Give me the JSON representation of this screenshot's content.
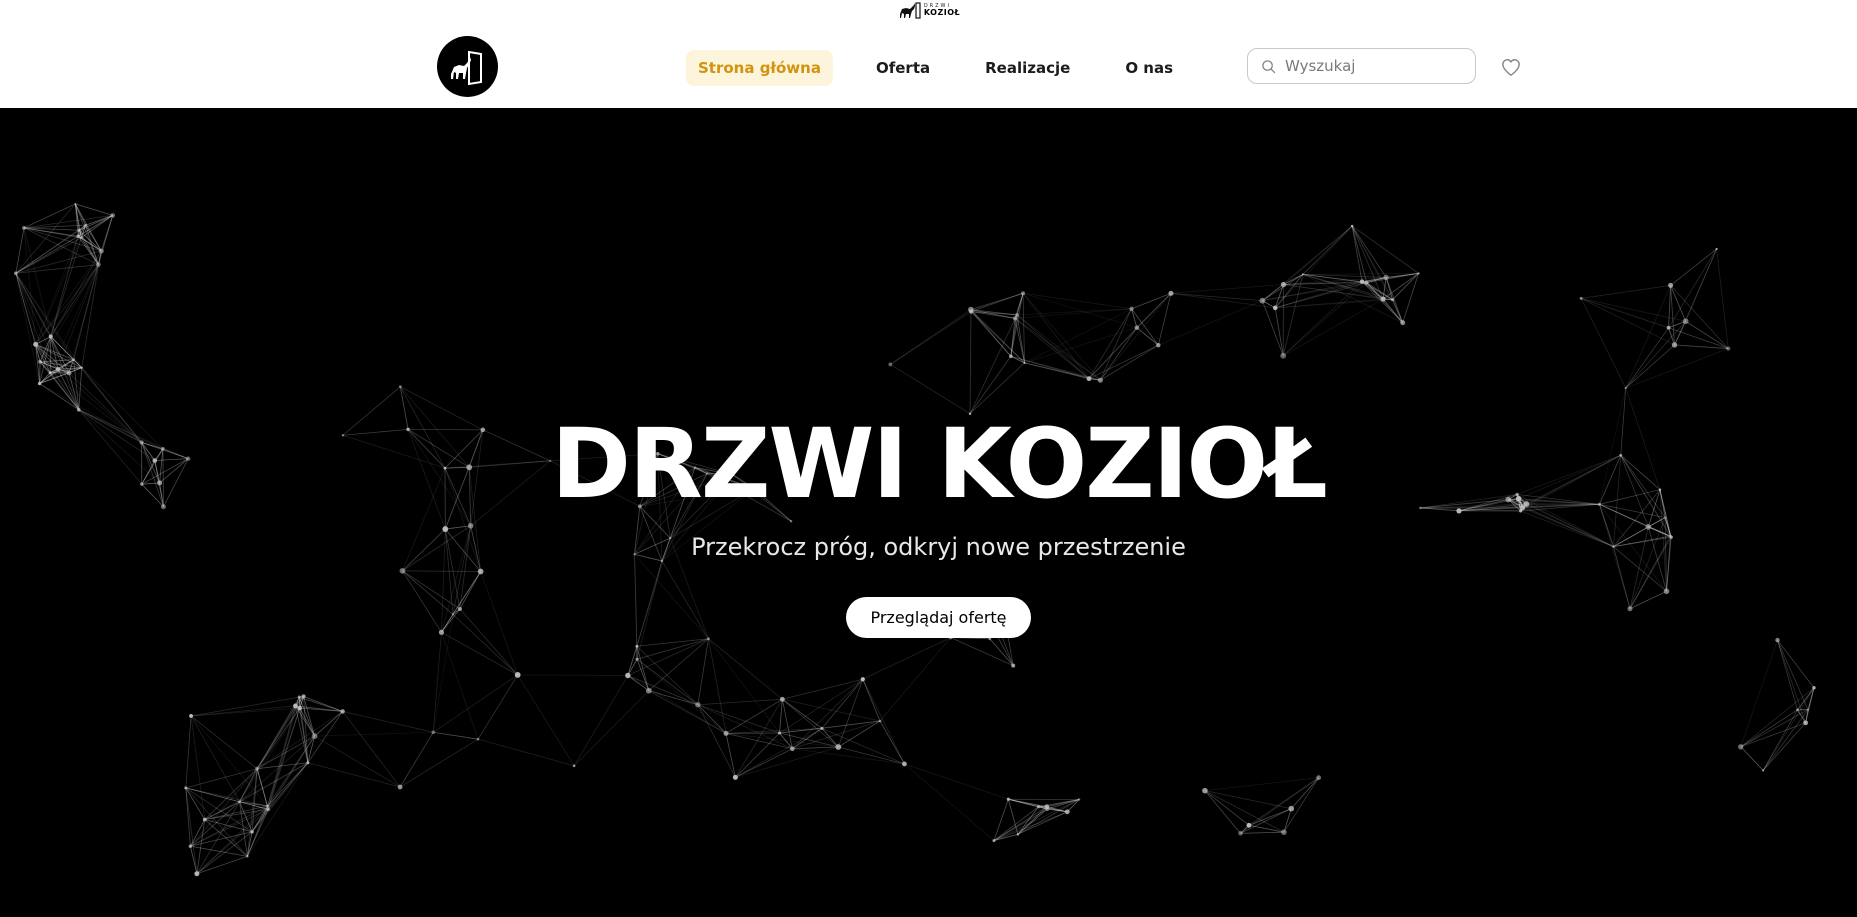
{
  "brand": {
    "mini_logo_small": "DRZWI",
    "mini_logo_big": "KOZIOŁ",
    "logo_icon": "goat-door-icon"
  },
  "nav": {
    "items": [
      {
        "label": "Strona główna",
        "active": true
      },
      {
        "label": "Oferta",
        "active": false
      },
      {
        "label": "Realizacje",
        "active": false
      },
      {
        "label": "O nas",
        "active": false
      }
    ]
  },
  "search": {
    "placeholder": "Wyszukaj",
    "value": "",
    "icon": "search-icon"
  },
  "wishlist": {
    "icon": "heart-icon"
  },
  "hero": {
    "title": "DRZWI KOZIOŁ",
    "subtitle": "Przekrocz próg, odkryj nowe przestrzenie",
    "cta_label": "Przeglądaj ofertę",
    "background": "particle-network"
  },
  "colors": {
    "accent": "#d29310",
    "accent_bg": "#fdf4dc",
    "hero_bg": "#000000",
    "text": "#1c1c1c"
  }
}
